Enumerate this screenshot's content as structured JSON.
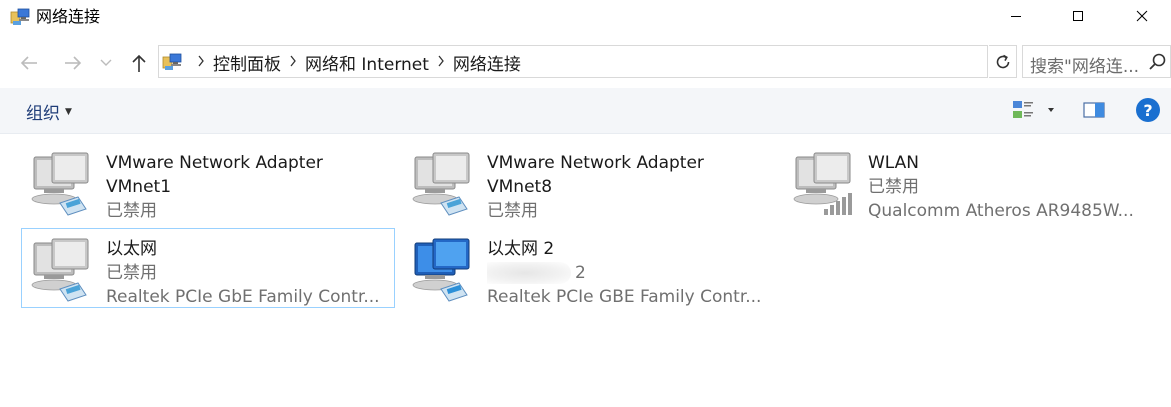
{
  "window": {
    "title": "网络连接"
  },
  "address": {
    "crumbs": [
      "控制面板",
      "网络和 Internet",
      "网络连接"
    ]
  },
  "search": {
    "placeholder": "搜索\"网络连..."
  },
  "toolbar": {
    "organize_label": "组织",
    "help_label": "?"
  },
  "items": [
    {
      "name_line1": "VMware Network Adapter",
      "name_line2": "VMnet1",
      "status": "已禁用",
      "icon": "network-adapter-disabled-icon"
    },
    {
      "name_line1": "VMware Network Adapter",
      "name_line2": "VMnet8",
      "status": "已禁用",
      "icon": "network-adapter-disabled-icon"
    },
    {
      "name_line1": "WLAN",
      "status": "已禁用",
      "device": "Qualcomm Atheros AR9485W...",
      "icon": "wireless-adapter-disabled-icon"
    },
    {
      "name_line1": "以太网",
      "status": "已禁用",
      "device": "Realtek PCIe GbE Family Contr...",
      "icon": "network-adapter-disabled-icon"
    },
    {
      "name_line1": "以太网 2",
      "status": "2",
      "device": "Realtek PCIe GBE Family Contr...",
      "icon": "network-adapter-active-icon"
    }
  ],
  "colors": {
    "accent": "#1a6fd0",
    "selection_border": "#99d1ff",
    "command_bar": "#f4f6f9",
    "secondary_text": "#707070"
  }
}
